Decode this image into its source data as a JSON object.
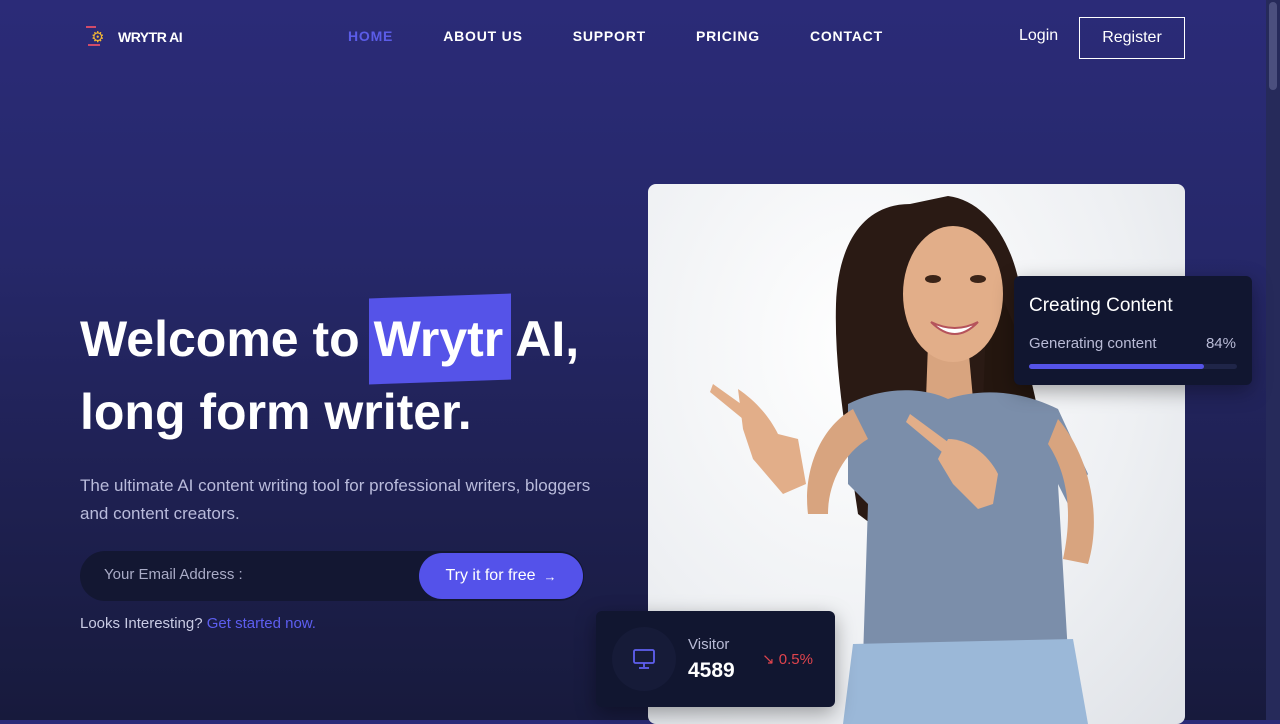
{
  "brand": {
    "name": "WRYTR AI",
    "logo_icon": "gear-icon"
  },
  "nav": {
    "items": [
      {
        "label": "HOME",
        "active": true
      },
      {
        "label": "ABOUT US",
        "active": false
      },
      {
        "label": "SUPPORT",
        "active": false
      },
      {
        "label": "PRICING",
        "active": false
      },
      {
        "label": "CONTACT",
        "active": false
      }
    ],
    "login_label": "Login",
    "register_label": "Register"
  },
  "hero": {
    "headline_prefix": "Welcome to ",
    "headline_highlight": "Wrytr",
    "headline_suffix": " AI,",
    "headline_line2": "long form writer.",
    "subtitle": "The ultimate AI content writing tool for professional writers, bloggers and content creators.",
    "email_placeholder": "Your Email Address :",
    "cta_label": "Try it for free",
    "cta_icon": "arrow-right-icon",
    "hint_text": "Looks Interesting?",
    "hint_link": "Get started now."
  },
  "content_card": {
    "title": "Creating Content",
    "label": "Generating content",
    "percent_text": "84%",
    "progress": 0.84
  },
  "visitor_card": {
    "icon": "monitor-icon",
    "label": "Visitor",
    "value": "4589",
    "change": "0.5%",
    "change_icon": "trend-down-icon"
  },
  "colors": {
    "accent": "#5553e8",
    "negative": "#e0444d",
    "background_top": "#2b2b78",
    "background_bottom": "#171a3c"
  }
}
